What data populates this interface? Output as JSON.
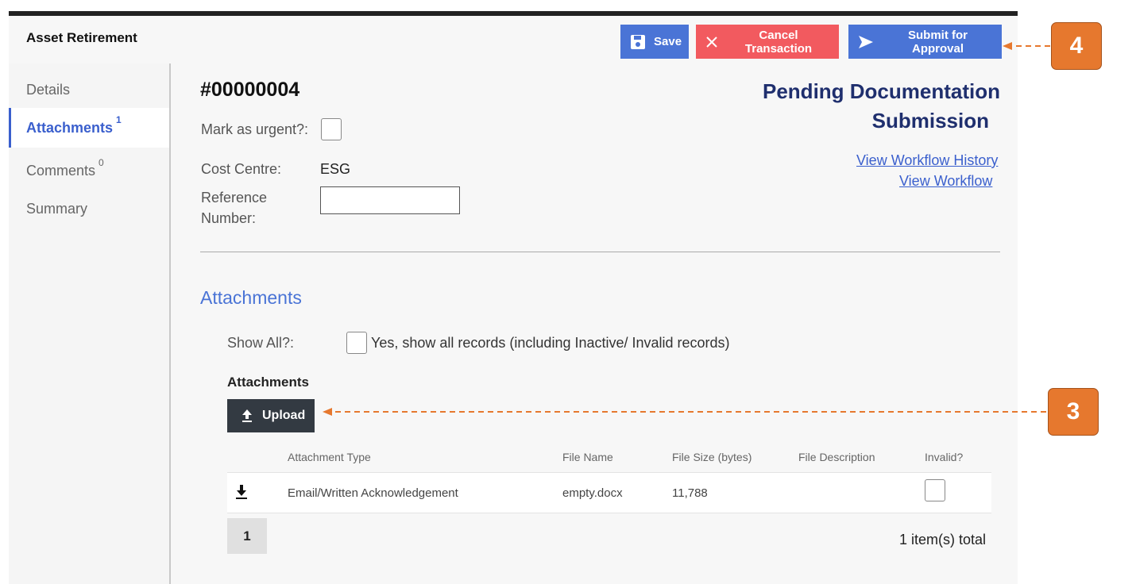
{
  "app": {
    "title": "Asset Retirement"
  },
  "header": {
    "save_label": "Save",
    "cancel_label": "Cancel Transaction",
    "submit_label": "Submit for Approval"
  },
  "sidebar": {
    "items": [
      {
        "label": "Details",
        "count": null
      },
      {
        "label": "Attachments",
        "count": "1"
      },
      {
        "label": "Comments",
        "count": "0"
      },
      {
        "label": "Summary",
        "count": null
      }
    ]
  },
  "transaction": {
    "id": "#00000004",
    "urgent_label": "Mark as urgent?:",
    "cost_centre_label": "Cost Centre:",
    "cost_centre_value": "ESG",
    "reference_label_line1": "Reference",
    "reference_label_line2": "Number:",
    "reference_value": "",
    "status_line1": "Pending Documentation",
    "status_line2": "Submission",
    "link_history": "View Workflow History",
    "link_workflow": "View Workflow"
  },
  "attachments": {
    "section_title": "Attachments",
    "show_all_label": "Show All?:",
    "show_all_option": "Yes, show all records (including Inactive/ Invalid records)",
    "table_title": "Attachments",
    "upload_label": "Upload",
    "columns": [
      "Attachment Type",
      "File Name",
      "File Size (bytes)",
      "File Description",
      "Invalid?"
    ],
    "rows": [
      {
        "type": "Email/Written Acknowledgement",
        "file_name": "empty.docx",
        "size": "11,788",
        "description": "",
        "invalid": false
      }
    ],
    "page": "1",
    "total": "1 item(s) total"
  },
  "callouts": {
    "submit_step": "4",
    "upload_step": "3"
  },
  "colors": {
    "accent": "#4a74d6",
    "danger": "#f25a5f",
    "callout": "#e6782e",
    "dark": "#333a42",
    "status": "#1f2f6e"
  }
}
